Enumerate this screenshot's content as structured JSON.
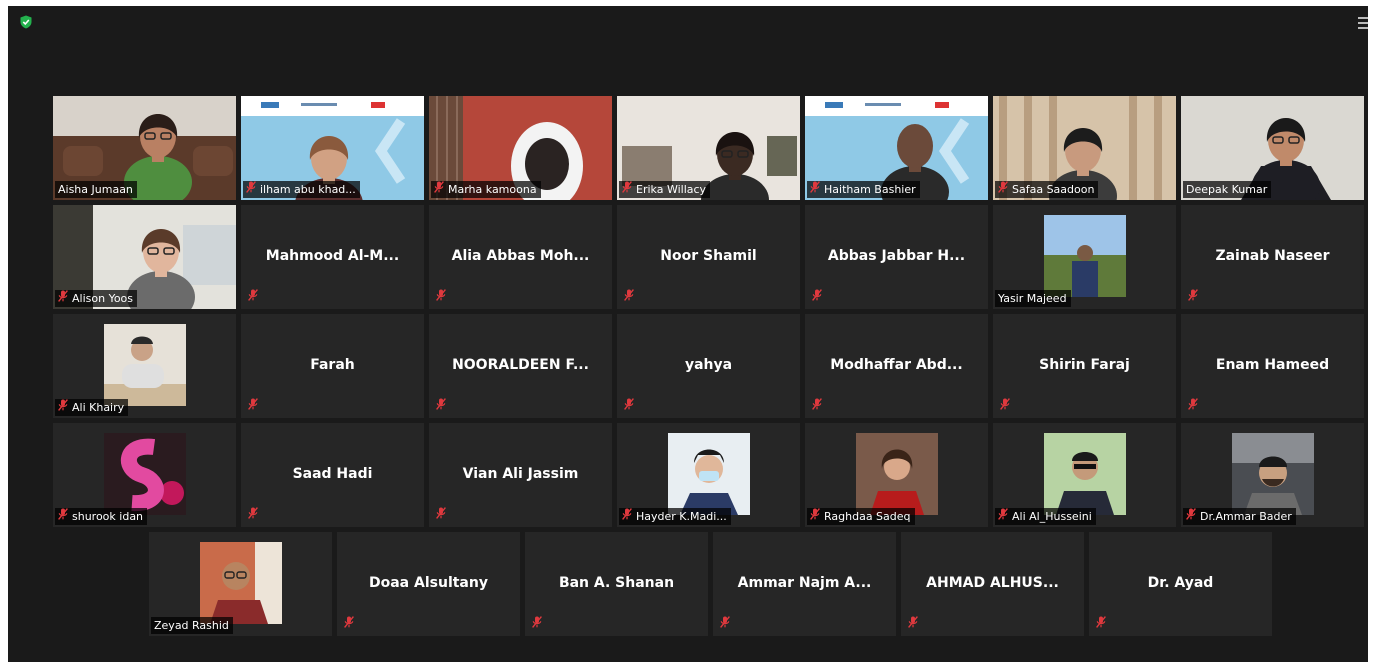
{
  "meeting": {
    "status_icon": "shield-check-icon",
    "menu_icon": "menu-icon",
    "active_speaker_color": "#d7e02c"
  },
  "rows": [
    [
      {
        "name": "Aisha Jumaan",
        "mode": "video",
        "scene": "woman-couch",
        "muted": false,
        "active": true
      },
      {
        "name": "ilham abu khad...",
        "mode": "video",
        "scene": "woman-banner",
        "muted": true
      },
      {
        "name": "Marha kamoona",
        "mode": "video",
        "scene": "hijab-red",
        "muted": true
      },
      {
        "name": "Erika Willacy",
        "mode": "video",
        "scene": "woman-dark",
        "muted": true
      },
      {
        "name": "Haitham Bashier",
        "mode": "video",
        "scene": "man-banner",
        "muted": true
      },
      {
        "name": "Safaa Saadoon",
        "mode": "video",
        "scene": "man-curtain",
        "muted": true
      },
      {
        "name": "Deepak Kumar",
        "mode": "video",
        "scene": "man-white",
        "muted": false
      }
    ],
    [
      {
        "name": "Alison Yoos",
        "mode": "video",
        "scene": "woman-glasses",
        "muted": true
      },
      {
        "name": "Mahmood  Al-M...",
        "mode": "name",
        "muted": true
      },
      {
        "name": "Alia  Abbas  Moh...",
        "mode": "name",
        "muted": true
      },
      {
        "name": "Noor Shamil",
        "mode": "name",
        "muted": true
      },
      {
        "name": "Abbas  Jabbar  H...",
        "mode": "name",
        "muted": true
      },
      {
        "name": "Yasir Majeed",
        "mode": "photo",
        "scene": "man-field",
        "muted": false
      },
      {
        "name": "Zainab Naseer",
        "mode": "name",
        "muted": true
      }
    ],
    [
      {
        "name": "Ali Khairy",
        "mode": "photo",
        "scene": "man-desk",
        "muted": true
      },
      {
        "name": "Farah",
        "mode": "name",
        "muted": true
      },
      {
        "name": "NOORALDEEN  F...",
        "mode": "name",
        "muted": true
      },
      {
        "name": "yahya",
        "mode": "name",
        "muted": true
      },
      {
        "name": "Modhaffar  Abd...",
        "mode": "name",
        "muted": true
      },
      {
        "name": "Shirin Faraj",
        "mode": "name",
        "muted": true
      },
      {
        "name": "Enam Hameed",
        "mode": "name",
        "muted": true
      }
    ],
    [
      {
        "name": "shurook idan",
        "mode": "photo",
        "scene": "letter-s",
        "muted": true
      },
      {
        "name": "Saad Hadi",
        "mode": "name",
        "muted": true
      },
      {
        "name": "Vian Ali Jassim",
        "mode": "name",
        "muted": true
      },
      {
        "name": "Hayder K.Madi...",
        "mode": "photo",
        "scene": "man-mask",
        "muted": true
      },
      {
        "name": "Raghdaa Sadeq",
        "mode": "photo",
        "scene": "woman-red",
        "muted": true
      },
      {
        "name": "Ali Al_Husseini",
        "mode": "photo",
        "scene": "man-suit",
        "muted": true
      },
      {
        "name": "Dr.Ammar Bader",
        "mode": "photo",
        "scene": "man-car",
        "muted": true
      }
    ],
    [
      {
        "name": "Zeyad Rashid",
        "mode": "photo",
        "scene": "man-bald",
        "muted": false
      },
      {
        "name": "Doaa Alsultany",
        "mode": "name",
        "muted": true
      },
      {
        "name": "Ban A. Shanan",
        "mode": "name",
        "muted": true
      },
      {
        "name": "Ammar Najm  A...",
        "mode": "name",
        "muted": true
      },
      {
        "name": "AHMAD  ALHUS...",
        "mode": "name",
        "muted": true
      },
      {
        "name": "Dr. Ayad",
        "mode": "name",
        "muted": true
      }
    ]
  ]
}
